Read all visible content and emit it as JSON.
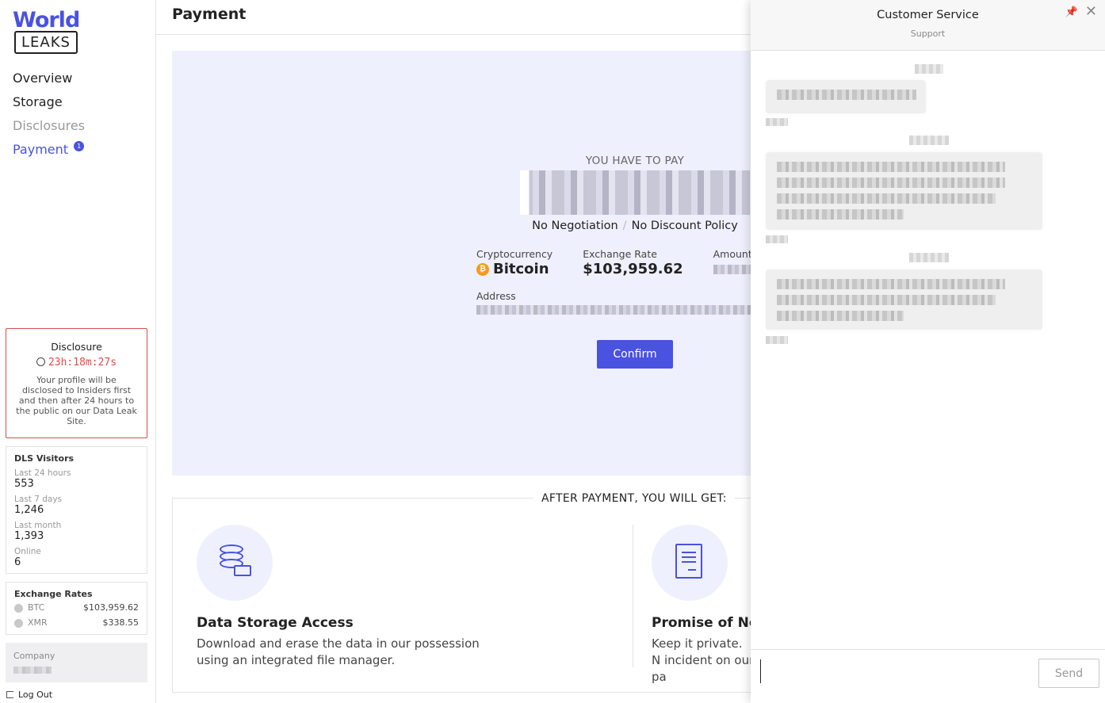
{
  "logo": {
    "line1": "World",
    "line2": "LEAKS"
  },
  "nav": {
    "items": [
      {
        "label": "Overview"
      },
      {
        "label": "Storage"
      },
      {
        "label": "Disclosures"
      },
      {
        "label": "Payment",
        "badge": "1"
      }
    ]
  },
  "disclosure": {
    "title": "Disclosure",
    "timer": "23h:18m:27s",
    "text": "Your profile will be disclosed to Insiders first and then after 24 hours to the public on our Data Leak Site."
  },
  "visitors": {
    "title": "DLS Visitors",
    "rows": [
      {
        "label": "Last 24 hours",
        "value": "553"
      },
      {
        "label": "Last 7 days",
        "value": "1,246"
      },
      {
        "label": "Last month",
        "value": "1,393"
      },
      {
        "label": "Online",
        "value": "6"
      }
    ]
  },
  "rates": {
    "title": "Exchange Rates",
    "rows": [
      {
        "name": "BTC",
        "value": "$103,959.62"
      },
      {
        "name": "XMR",
        "value": "$338.55"
      }
    ]
  },
  "company": {
    "label": "Company"
  },
  "logout": {
    "label": "Log Out"
  },
  "header": {
    "title": "Payment"
  },
  "payment": {
    "heading": "YOU HAVE TO PAY",
    "policy_a": "No Negotiation",
    "policy_sep": "/",
    "policy_b": "No Discount Policy",
    "crypto_label": "Cryptocurrency",
    "crypto_value": "Bitcoin",
    "rate_label": "Exchange Rate",
    "rate_value": "$103,959.62",
    "amount_label": "Amount",
    "address_label": "Address",
    "confirm_label": "Confirm"
  },
  "after": {
    "title": "AFTER PAYMENT, YOU WILL GET:",
    "features": [
      {
        "title": "Data Storage Access",
        "desc": "Download and erase the data in our possession using an integrated file manager.",
        "icon": "database-icon"
      },
      {
        "title": "Promise of Non",
        "desc": "Keep it private. N incident on our pa",
        "icon": "document-icon"
      }
    ]
  },
  "chat": {
    "title": "Customer Service",
    "subtitle": "Support",
    "pin": "📌",
    "close": "✕",
    "input_placeholder": "",
    "send_label": "Send"
  },
  "colors": {
    "accent": "#4a52e0",
    "danger": "#e04b4b",
    "panel": "#eef0fd",
    "bitcoin": "#f49b1a"
  }
}
